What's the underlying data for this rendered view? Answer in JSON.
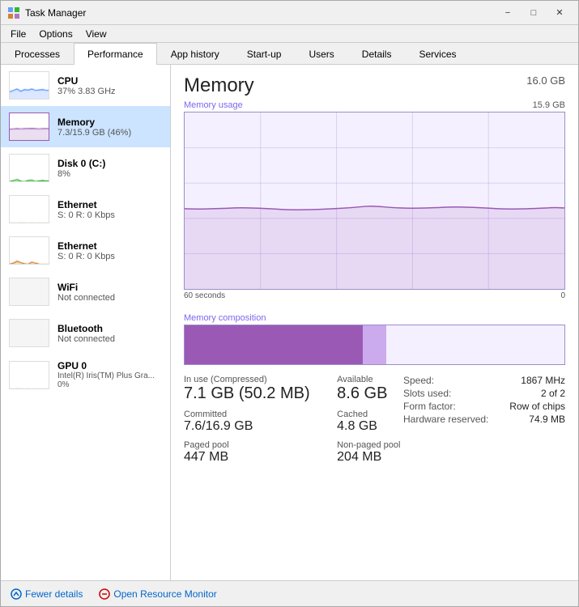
{
  "window": {
    "title": "Task Manager",
    "icon": "📊"
  },
  "menu": {
    "items": [
      "File",
      "Options",
      "View"
    ]
  },
  "tabs": [
    {
      "label": "Processes",
      "active": false
    },
    {
      "label": "Performance",
      "active": true
    },
    {
      "label": "App history",
      "active": false
    },
    {
      "label": "Start-up",
      "active": false
    },
    {
      "label": "Users",
      "active": false
    },
    {
      "label": "Details",
      "active": false
    },
    {
      "label": "Services",
      "active": false
    }
  ],
  "sidebar": {
    "items": [
      {
        "name": "CPU",
        "value": "37% 3.83 GHz",
        "active": false,
        "color": "#4488ff"
      },
      {
        "name": "Memory",
        "value": "7.3/15.9 GB (46%)",
        "active": true,
        "color": "#9b59b6"
      },
      {
        "name": "Disk 0 (C:)",
        "value": "8%",
        "active": false,
        "color": "#00aa00"
      },
      {
        "name": "Ethernet",
        "value": "S: 0 R: 0 Kbps",
        "active": false,
        "color": "#cc6600"
      },
      {
        "name": "Ethernet",
        "value": "S: 0 R: 0 Kbps",
        "active": false,
        "color": "#cc6600"
      },
      {
        "name": "WiFi",
        "value": "Not connected",
        "active": false,
        "color": "#aaa"
      },
      {
        "name": "Bluetooth",
        "value": "Not connected",
        "active": false,
        "color": "#aaa"
      },
      {
        "name": "GPU 0",
        "value": "Intel(R) Iris(TM) Plus Gra...\n0%",
        "active": false,
        "color": "#4488ff"
      }
    ]
  },
  "main": {
    "title": "Memory",
    "total": "16.0 GB",
    "chart": {
      "label": "Memory usage",
      "max_label": "15.9 GB",
      "time_start": "60 seconds",
      "time_end": "0"
    },
    "composition": {
      "label": "Memory composition",
      "segments": [
        {
          "color": "#9b59b6",
          "width": 47
        },
        {
          "color": "#ccaaee",
          "width": 6
        },
        {
          "color": "#f0f0f0",
          "width": 47
        }
      ]
    },
    "stats": {
      "in_use_label": "In use (Compressed)",
      "in_use_value": "7.1 GB (50.2 MB)",
      "available_label": "Available",
      "available_value": "8.6 GB",
      "committed_label": "Committed",
      "committed_value": "7.6/16.9 GB",
      "cached_label": "Cached",
      "cached_value": "4.8 GB",
      "paged_pool_label": "Paged pool",
      "paged_pool_value": "447 MB",
      "non_paged_pool_label": "Non-paged pool",
      "non_paged_pool_value": "204 MB"
    },
    "right_stats": {
      "speed_label": "Speed:",
      "speed_value": "1867 MHz",
      "slots_label": "Slots used:",
      "slots_value": "2 of 2",
      "form_label": "Form factor:",
      "form_value": "Row of chips",
      "reserved_label": "Hardware reserved:",
      "reserved_value": "74.9 MB"
    }
  },
  "footer": {
    "fewer_details": "Fewer details",
    "open_monitor": "Open Resource Monitor"
  }
}
